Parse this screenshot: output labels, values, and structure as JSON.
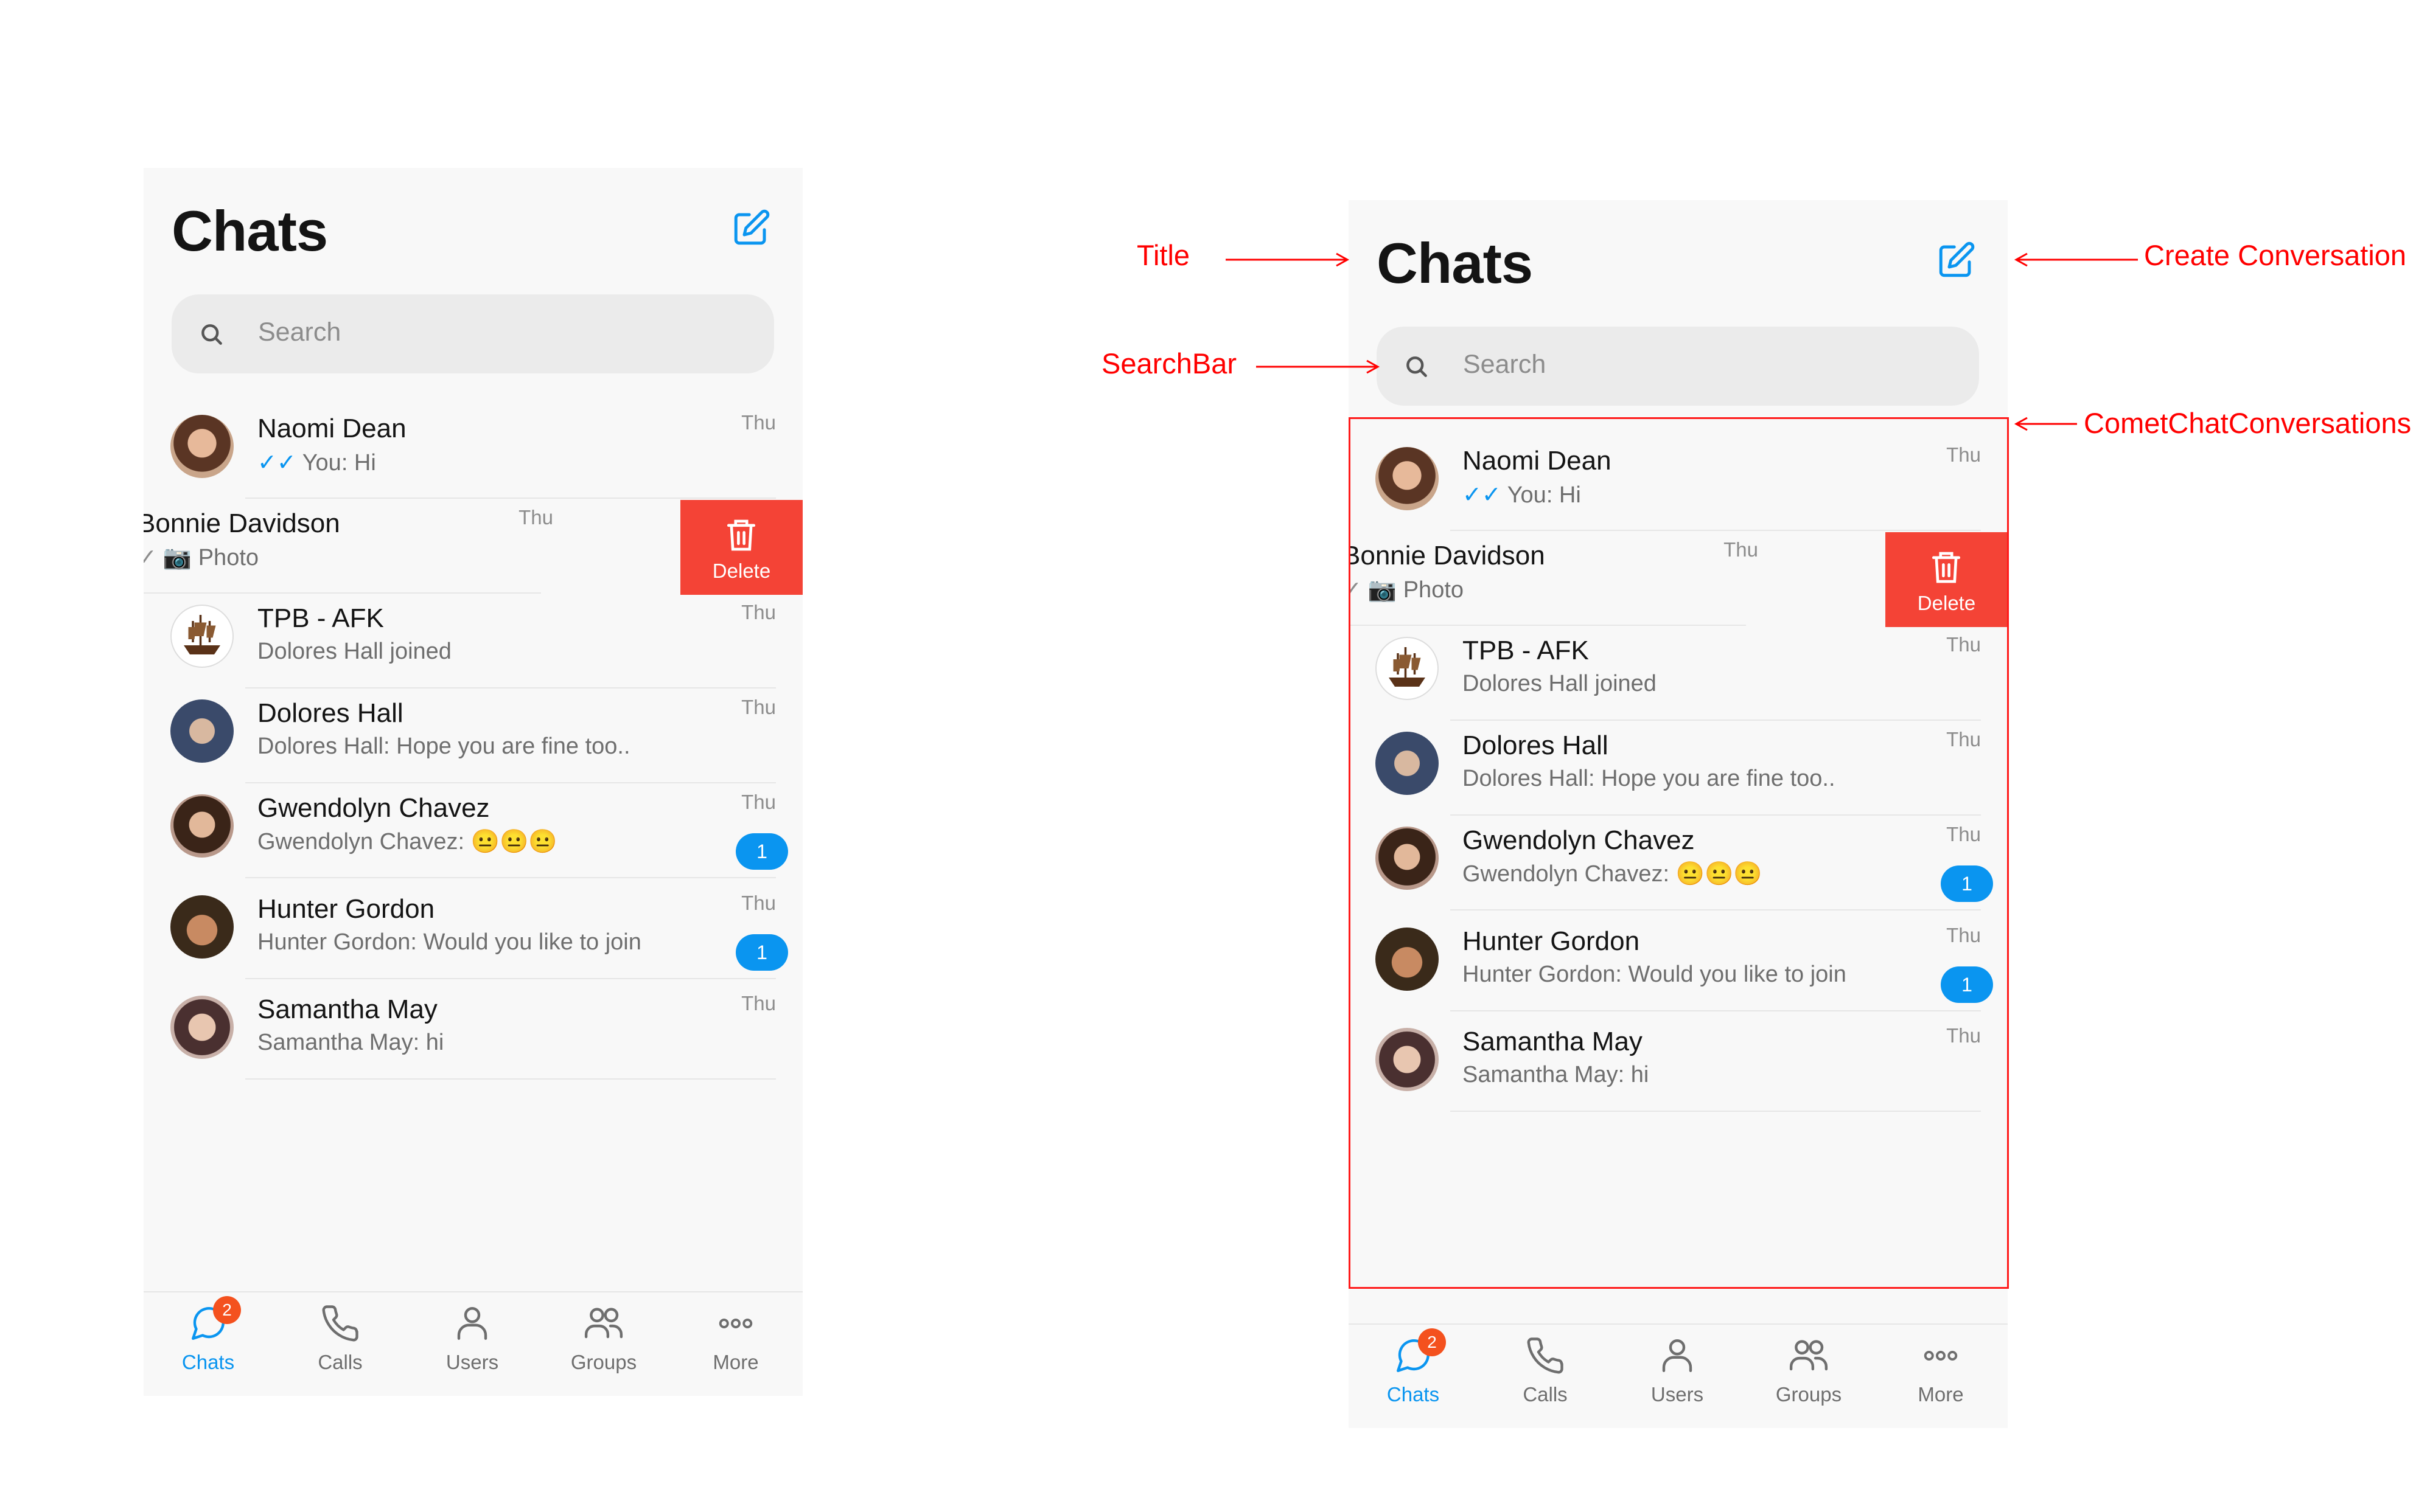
{
  "title": "Chats",
  "search": {
    "placeholder": "Search"
  },
  "conversations": [
    {
      "name": "Naomi Dean",
      "preview": "You: Hi",
      "time": "Thu",
      "tick": "✓✓",
      "avatar_color": "#b87a5a"
    },
    {
      "name": "Bonnie Davidson",
      "preview": "📷 Photo",
      "time": "Thu",
      "tick": "✓",
      "swiped": true
    },
    {
      "name": "TPB - AFK",
      "preview": "Dolores Hall joined",
      "time": "Thu",
      "avatar_color": "#7a4a2a"
    },
    {
      "name": "Dolores Hall",
      "preview": "Dolores Hall: Hope you are fine too..",
      "time": "Thu",
      "avatar_color": "#4a5a7a"
    },
    {
      "name": "Gwendolyn Chavez",
      "preview": "Gwendolyn Chavez: 😐😐😐",
      "time": "Thu",
      "unread": "1",
      "avatar_color": "#5a3a2a"
    },
    {
      "name": "Hunter Gordon",
      "preview": "Hunter Gordon: Would you like to join",
      "time": "Thu",
      "unread": "1",
      "avatar_color": "#8a5a3a"
    },
    {
      "name": "Samantha May",
      "preview": "Samantha May: hi",
      "time": "Thu",
      "avatar_color": "#6a4a4a"
    }
  ],
  "swipe_action": {
    "label": "Delete"
  },
  "nav": {
    "chats": "Chats",
    "calls": "Calls",
    "users": "Users",
    "groups": "Groups",
    "more": "More",
    "chats_badge": "2"
  },
  "annotations": {
    "title": "Title",
    "searchbar": "SearchBar",
    "create": "Create Conversation",
    "conversations": "CometChatConversations"
  },
  "colors": {
    "accent": "#0a95f0",
    "delete": "#f44336",
    "annotation": "#ff0000",
    "nav_badge": "#f4511e"
  }
}
